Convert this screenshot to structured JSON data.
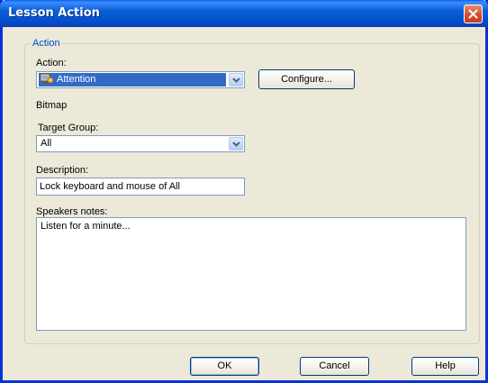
{
  "window": {
    "title": "Lesson Action"
  },
  "group": {
    "label": "Action"
  },
  "action": {
    "label": "Action:",
    "value": "Attention",
    "configure_label": "Configure..."
  },
  "bitmap": {
    "label": "Bitmap"
  },
  "target": {
    "label": "Target Group:",
    "value": "All"
  },
  "description": {
    "label": "Description:",
    "value": "Lock keyboard and mouse of All"
  },
  "notes": {
    "label": "Speakers notes:",
    "value": "Listen for a minute..."
  },
  "buttons": {
    "ok": "OK",
    "cancel": "Cancel",
    "help": "Help"
  },
  "colors": {
    "titlebar": "#0a5fd6",
    "selection": "#316ac5",
    "group_label": "#0046d5"
  }
}
